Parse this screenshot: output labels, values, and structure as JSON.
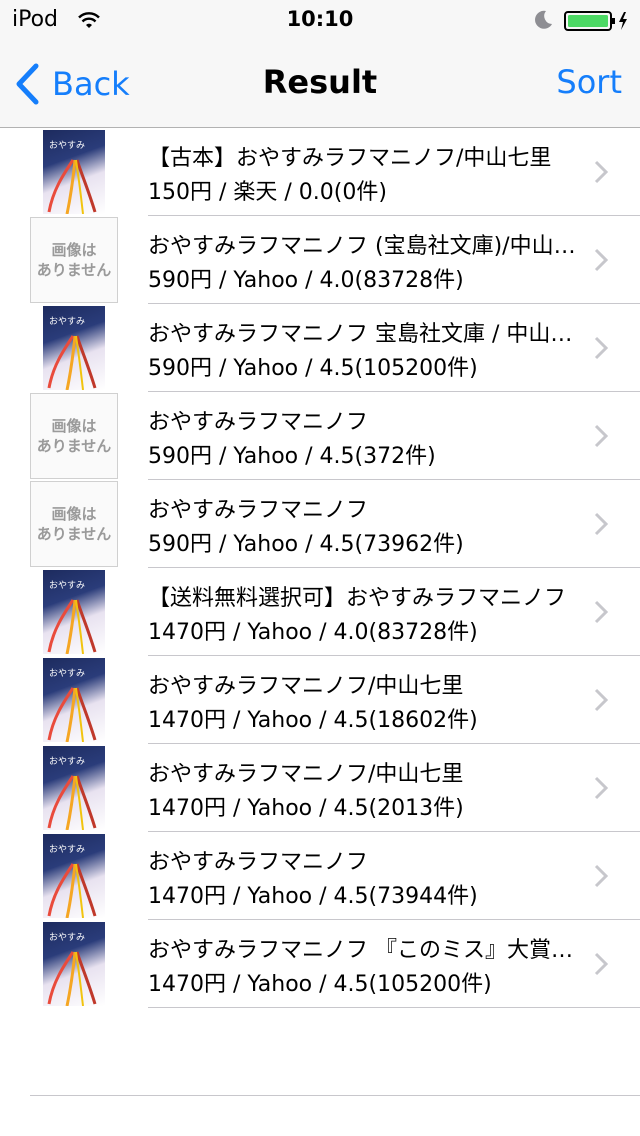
{
  "status_bar": {
    "carrier": "iPod",
    "time": "10:10"
  },
  "nav": {
    "back_label": "Back",
    "title": "Result",
    "sort_label": "Sort"
  },
  "no_image": {
    "line1": "画像は",
    "line2": "ありません"
  },
  "results": [
    {
      "title": "【古本】おやすみラフマニノフ/中山七里",
      "subtitle": "150円 / 楽天 / 0.0(0件)",
      "thumb": "cover"
    },
    {
      "title": "おやすみラフマニノフ (宝島社文庫)/中山七里",
      "subtitle": "590円 / Yahoo / 4.0(83728件)",
      "thumb": "none"
    },
    {
      "title": "おやすみラフマニノフ 宝島社文庫 / 中山七里",
      "subtitle": "590円 / Yahoo / 4.5(105200件)",
      "thumb": "cover"
    },
    {
      "title": "おやすみラフマニノフ",
      "subtitle": "590円 / Yahoo / 4.5(372件)",
      "thumb": "none"
    },
    {
      "title": "おやすみラフマニノフ",
      "subtitle": "590円 / Yahoo / 4.5(73962件)",
      "thumb": "none"
    },
    {
      "title": "【送料無料選択可】おやすみラフマニノフ",
      "subtitle": "1470円 / Yahoo / 4.0(83728件)",
      "thumb": "cover"
    },
    {
      "title": "おやすみラフマニノフ/中山七里",
      "subtitle": "1470円 / Yahoo / 4.5(18602件)",
      "thumb": "cover"
    },
    {
      "title": "おやすみラフマニノフ/中山七里",
      "subtitle": "1470円 / Yahoo / 4.5(2013件)",
      "thumb": "cover"
    },
    {
      "title": "おやすみラフマニノフ",
      "subtitle": "1470円 / Yahoo / 4.5(73944件)",
      "thumb": "cover"
    },
    {
      "title": "おやすみラフマニノフ 『このミス』大賞シリーズ",
      "subtitle": "1470円 / Yahoo / 4.5(105200件)",
      "thumb": "cover"
    }
  ],
  "colors": {
    "accent": "#157efb",
    "battery": "#4cd964"
  },
  "icons": [
    "wifi-icon",
    "moon-icon",
    "battery-icon",
    "back-chevron-icon",
    "chevron-right-icon"
  ]
}
